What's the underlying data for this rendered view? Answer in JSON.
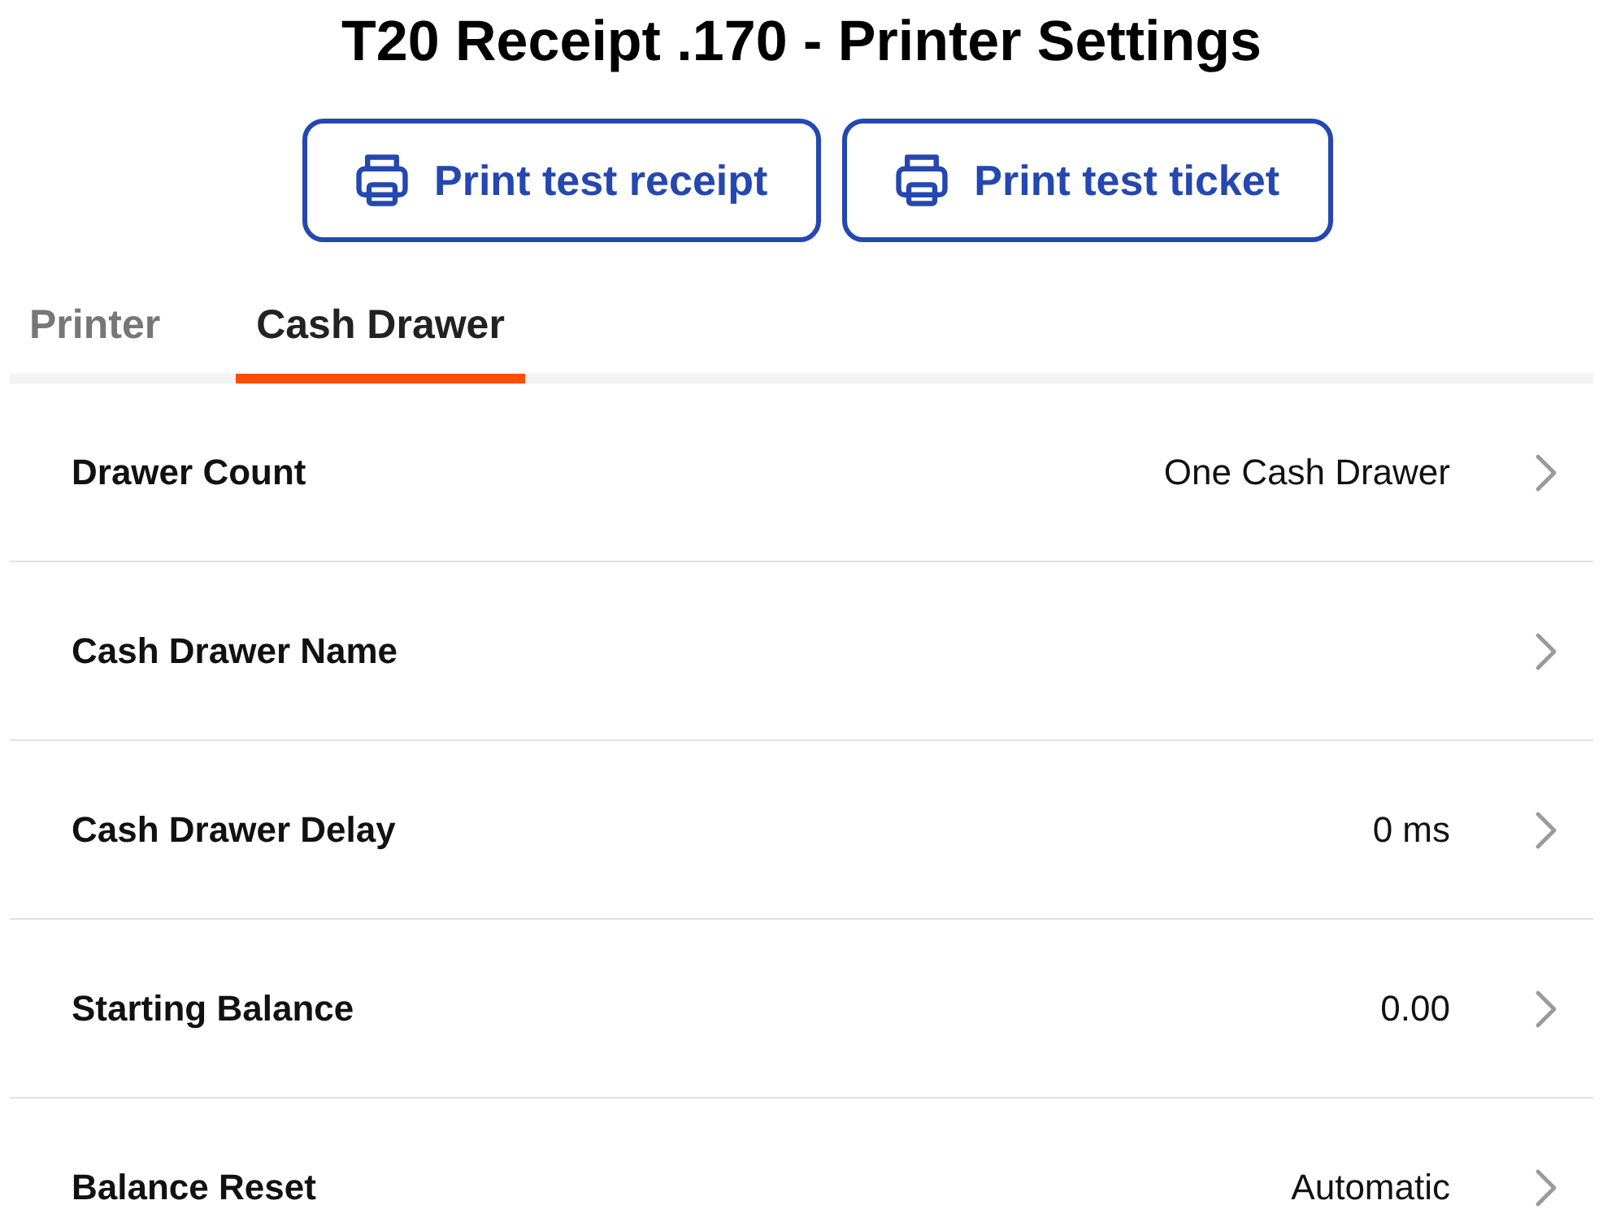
{
  "title": "T20 Receipt .170 - Printer Settings",
  "actions": [
    {
      "label": "Print test receipt"
    },
    {
      "label": "Print test ticket"
    }
  ],
  "tabs": [
    {
      "label": "Printer",
      "selected": false
    },
    {
      "label": "Cash Drawer",
      "selected": true
    }
  ],
  "settings": [
    {
      "label": "Drawer Count",
      "value": "One Cash Drawer"
    },
    {
      "label": "Cash Drawer Name"
    },
    {
      "label": "Cash Drawer Delay",
      "value": "0 ms"
    },
    {
      "label": "Starting Balance",
      "value": "0.00"
    },
    {
      "label": "Balance Reset",
      "value": "Automatic"
    }
  ]
}
